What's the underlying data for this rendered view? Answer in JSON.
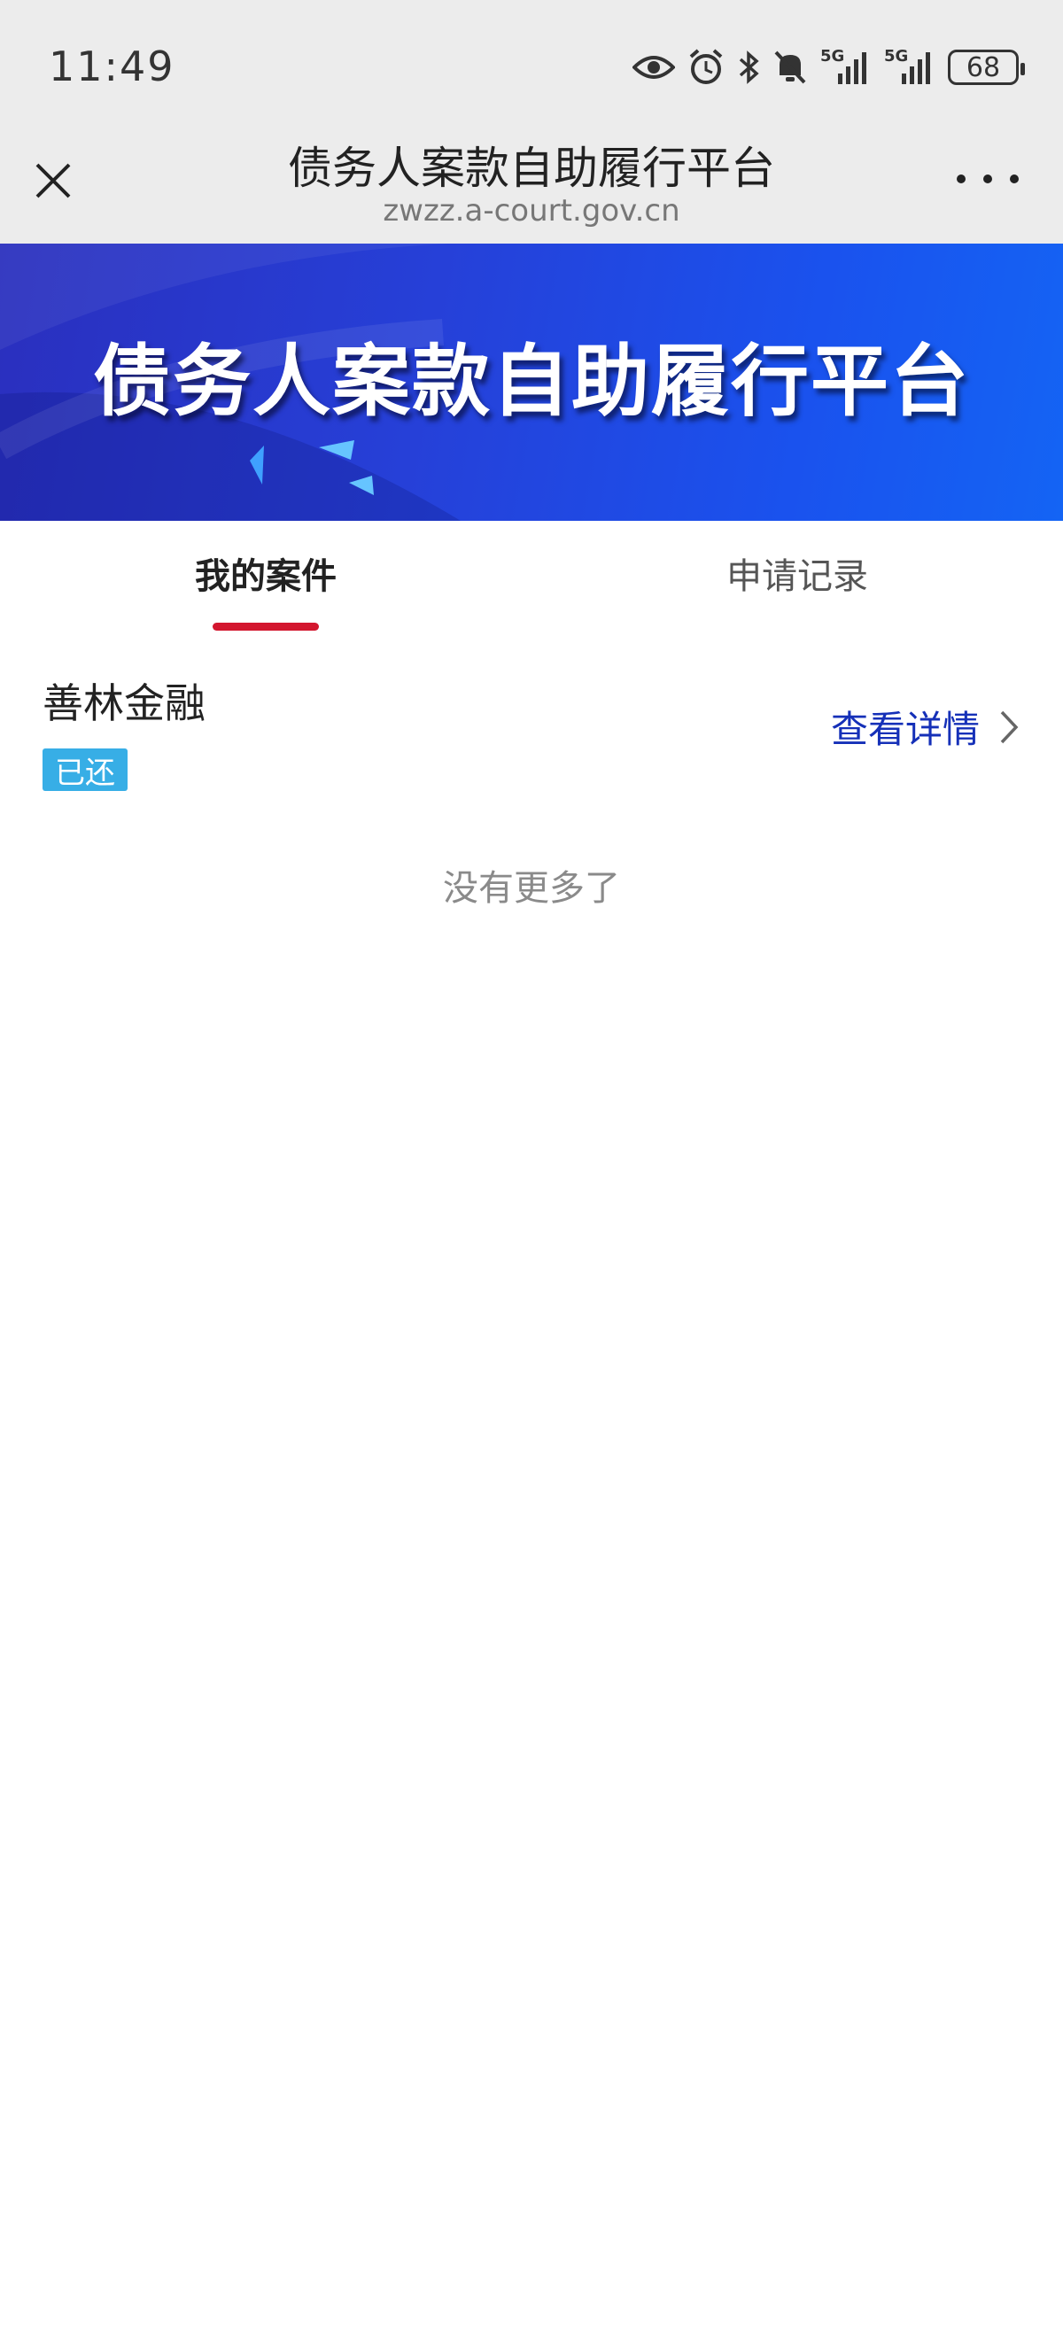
{
  "status_bar": {
    "time": "11:49",
    "network_1": "5G",
    "network_2": "5G",
    "battery": "68",
    "icons": [
      "eye-icon",
      "alarm-icon",
      "bluetooth-icon",
      "mute-icon",
      "signal-icon",
      "signal-icon",
      "battery-icon"
    ]
  },
  "browser": {
    "title": "债务人案款自助履行平台",
    "url": "zwzz.a-court.gov.cn",
    "close_icon": "close-icon",
    "more_icon": "more-icon"
  },
  "banner": {
    "title": "债务人案款自助履行平台"
  },
  "tabs": [
    {
      "label": "我的案件",
      "active": true
    },
    {
      "label": "申请记录",
      "active": false
    }
  ],
  "accent_color": "#d3162e",
  "cases": [
    {
      "name": "善林金融",
      "status": "已还",
      "status_color": "#37aee6",
      "detail_label": "查看详情"
    }
  ],
  "footer_text": "没有更多了"
}
